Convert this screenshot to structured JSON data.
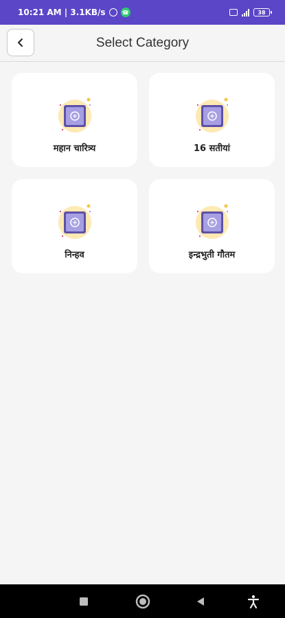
{
  "status_bar": {
    "time_speed": "10:21 AM | 3.1KB/s",
    "battery": "38"
  },
  "header": {
    "title": "Select Category"
  },
  "categories": [
    {
      "label": "महान चारित्र्य"
    },
    {
      "label": "16 सतीयां"
    },
    {
      "label": "निन्हव"
    },
    {
      "label": "इन्द्रभुती गौतम"
    }
  ],
  "colors": {
    "status_bar": "#5a46c6",
    "icon_circle": "#fde9b4",
    "icon_box": "#8b80cf",
    "background": "#f5f5f5"
  },
  "icons": {
    "back": "chevron-left-icon",
    "category": "safe-box-icon"
  }
}
